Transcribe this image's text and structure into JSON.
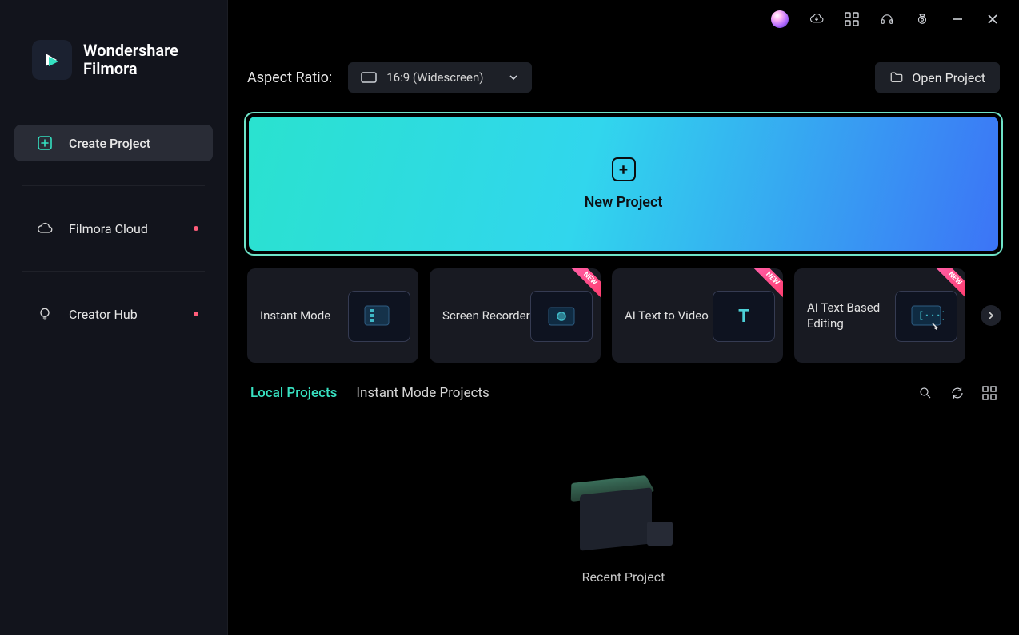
{
  "brand": {
    "line1": "Wondershare",
    "line2": "Filmora"
  },
  "nav": {
    "create": "Create Project",
    "cloud": "Filmora Cloud",
    "hub": "Creator Hub"
  },
  "controls": {
    "aspect_label": "Aspect Ratio:",
    "aspect_value": "16:9 (Widescreen)",
    "open_project": "Open Project"
  },
  "new_project_label": "New Project",
  "cards": {
    "c0": "Instant Mode",
    "c1": "Screen Recorder",
    "c2": "AI Text to Video",
    "c3": "AI Text Based Editing"
  },
  "tabs": {
    "local": "Local Projects",
    "instant": "Instant Mode Projects"
  },
  "recent_label": "Recent Project"
}
